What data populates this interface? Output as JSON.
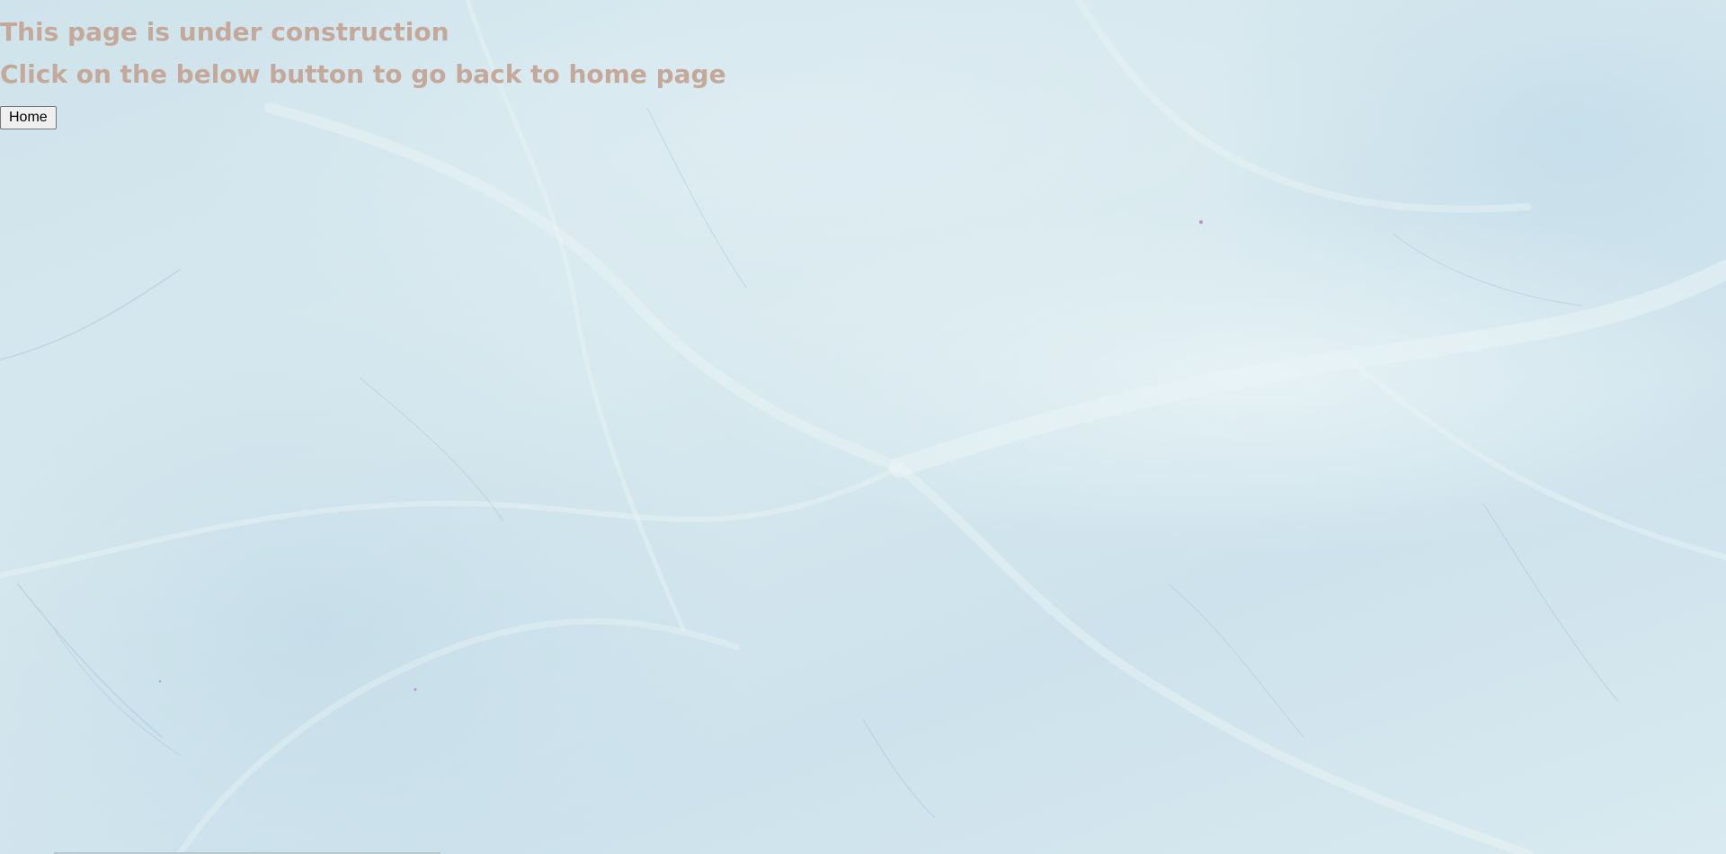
{
  "page": {
    "heading_line1": "This page is under construction",
    "heading_line2": "Click on the below button to go back to home page",
    "home_button_label": "Home"
  },
  "colors": {
    "heading_text": "#c4a99a",
    "background": "#d3e6ee"
  }
}
